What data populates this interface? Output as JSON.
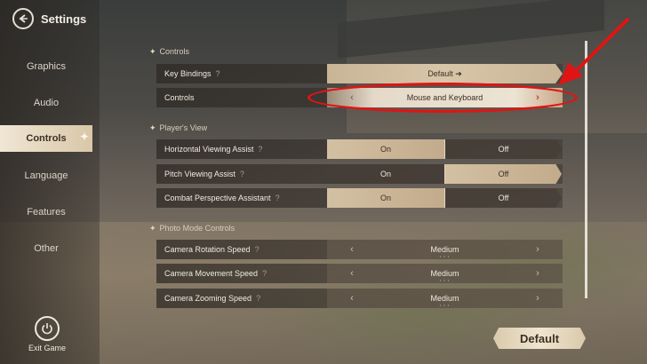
{
  "header": {
    "title": "Settings"
  },
  "sidebar": {
    "items": [
      {
        "label": "Graphics"
      },
      {
        "label": "Audio"
      },
      {
        "label": "Controls"
      },
      {
        "label": "Language"
      },
      {
        "label": "Features"
      },
      {
        "label": "Other"
      }
    ],
    "active": "Controls",
    "exit_label": "Exit Game"
  },
  "sections": {
    "controls": {
      "title": "Controls",
      "key_bindings": {
        "label": "Key Bindings",
        "value": "Default ➔"
      },
      "controls": {
        "label": "Controls",
        "value": "Mouse and Keyboard"
      }
    },
    "view": {
      "title": "Player's View",
      "horizontal": {
        "label": "Horizontal Viewing Assist",
        "on": "On",
        "off": "Off",
        "selected": "On"
      },
      "pitch": {
        "label": "Pitch Viewing Assist",
        "on": "On",
        "off": "Off",
        "selected": "Off"
      },
      "combat": {
        "label": "Combat Perspective Assistant",
        "on": "On",
        "off": "Off",
        "selected": "On"
      }
    },
    "photo": {
      "title": "Photo Mode Controls",
      "rotation": {
        "label": "Camera Rotation Speed",
        "value": "Medium"
      },
      "movement": {
        "label": "Camera Movement Speed",
        "value": "Medium"
      },
      "zooming": {
        "label": "Camera Zooming Speed",
        "value": "Medium"
      }
    }
  },
  "glyphs": {
    "help": "?",
    "left": "‹",
    "right": "›",
    "section_marker": "✦"
  },
  "default_button": "Default",
  "annotation_color": "#e01414"
}
